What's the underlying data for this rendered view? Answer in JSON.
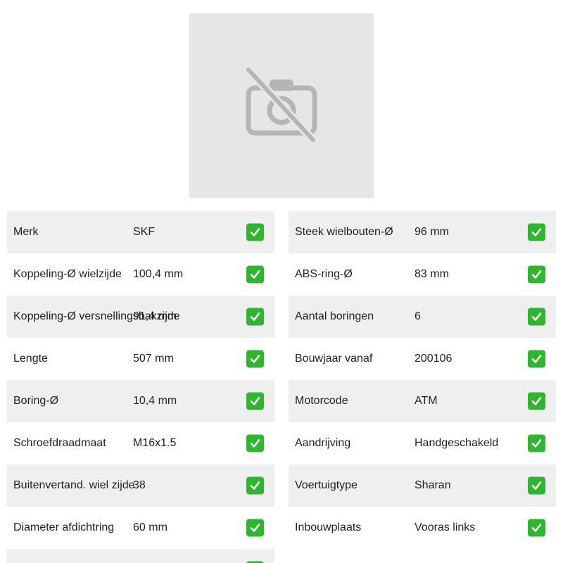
{
  "image": {
    "icon": "camera-off-icon"
  },
  "colors": {
    "check": "#2fb52f",
    "stripe": "#efefef",
    "placeholder_bg": "#e6e6e6"
  },
  "specs_left": [
    {
      "label": "Merk",
      "value": "SKF"
    },
    {
      "label": "Koppeling-Ø wielzijde",
      "value": "100,4 mm"
    },
    {
      "label": "Koppeling-Ø versnellingsbakzijde",
      "value": "91,4 mm"
    },
    {
      "label": "Lengte",
      "value": "507 mm"
    },
    {
      "label": "Boring-Ø",
      "value": "10,4 mm"
    },
    {
      "label": "Schroefdraadmaat",
      "value": "M16x1.5"
    },
    {
      "label": "Buitenvertand. wiel zijde",
      "value": "38"
    },
    {
      "label": "Diameter afdichtring",
      "value": "60 mm"
    },
    {
      "label": "",
      "value": ""
    }
  ],
  "specs_right": [
    {
      "label": "Steek wielbouten-Ø",
      "value": "96 mm"
    },
    {
      "label": "ABS-ring-Ø",
      "value": "83 mm"
    },
    {
      "label": "Aantal boringen",
      "value": "6"
    },
    {
      "label": "Bouwjaar vanaf",
      "value": "200106"
    },
    {
      "label": "Motorcode",
      "value": "ATM"
    },
    {
      "label": "Aandrijving",
      "value": "Handgeschakeld"
    },
    {
      "label": "Voertuigtype",
      "value": "Sharan"
    },
    {
      "label": "Inbouwplaats",
      "value": "Vooras links"
    }
  ]
}
